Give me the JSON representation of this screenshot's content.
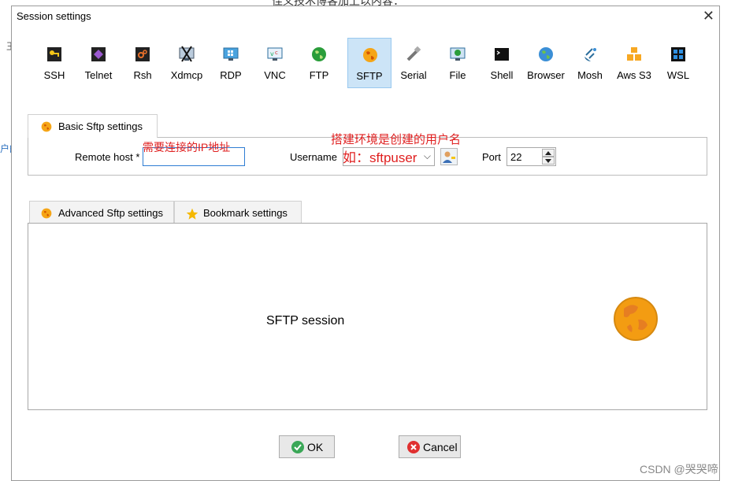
{
  "background": {
    "top_text": "佳义技术博客加上以内容：",
    "left_glyph": "王",
    "left_link": "户的"
  },
  "dialog": {
    "title": "Session settings",
    "close_label": "✕"
  },
  "protocols": [
    {
      "label": "SSH",
      "icon": "key-icon"
    },
    {
      "label": "Telnet",
      "icon": "telnet-icon"
    },
    {
      "label": "Rsh",
      "icon": "rsh-icon"
    },
    {
      "label": "Xdmcp",
      "icon": "xdmcp-icon"
    },
    {
      "label": "RDP",
      "icon": "rdp-icon"
    },
    {
      "label": "VNC",
      "icon": "vnc-icon"
    },
    {
      "label": "FTP",
      "icon": "ftp-globe-icon"
    },
    {
      "label": "SFTP",
      "icon": "sftp-globe-icon",
      "selected": true
    },
    {
      "label": "Serial",
      "icon": "serial-plug-icon"
    },
    {
      "label": "File",
      "icon": "file-icon"
    },
    {
      "label": "Shell",
      "icon": "terminal-icon"
    },
    {
      "label": "Browser",
      "icon": "browser-globe-icon"
    },
    {
      "label": "Mosh",
      "icon": "satellite-icon"
    },
    {
      "label": "Aws S3",
      "icon": "aws-cubes-icon"
    },
    {
      "label": "WSL",
      "icon": "windows-icon"
    }
  ],
  "basic": {
    "tab_label": "Basic Sftp settings",
    "remote_host_label": "Remote host *",
    "remote_host_value": "",
    "username_label": "Username",
    "username_value": "",
    "port_label": "Port",
    "port_value": "22"
  },
  "annotations": {
    "host_note": "需要连接的IP地址",
    "user_note": "搭建环境是创建的用户名",
    "user_example": "如：sftpuser"
  },
  "advanced_tabs": [
    {
      "label": "Advanced Sftp settings",
      "icon": "sftp-globe-icon"
    },
    {
      "label": "Bookmark settings",
      "icon": "star-icon"
    }
  ],
  "main": {
    "session_label": "SFTP session"
  },
  "buttons": {
    "ok_label": "OK",
    "cancel_label": "Cancel"
  },
  "watermark": "CSDN @哭哭啼",
  "colors": {
    "selected_tab_bg": "#cce4f7",
    "annotation": "#e02020",
    "sftp_orange": "#f39c12"
  }
}
